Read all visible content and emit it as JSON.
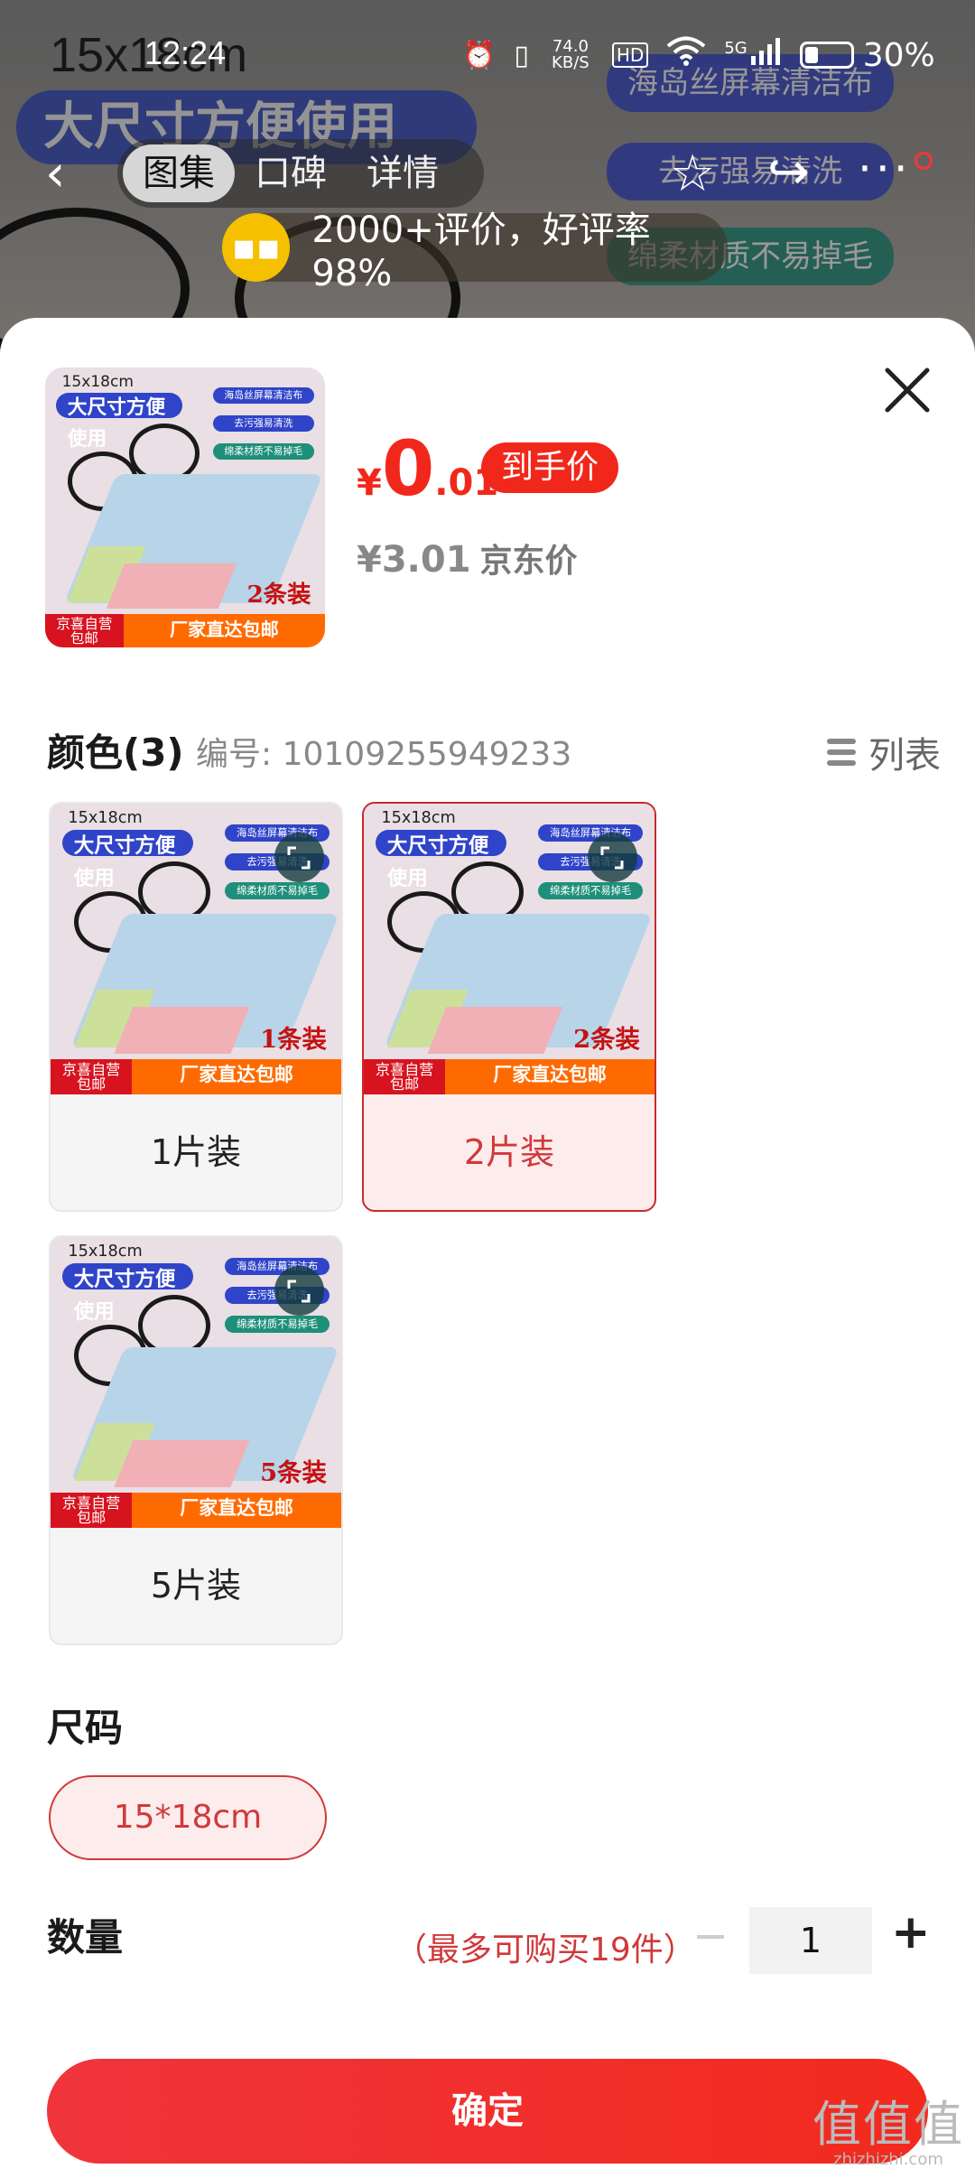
{
  "status_bar": {
    "time": "12:24",
    "net_speed": "74.0 KB/S",
    "net_type": "5G",
    "hd": "HD",
    "battery": "30%"
  },
  "background": {
    "size_text": "15x18cm",
    "banner": "大尺寸方便使用",
    "pills": [
      "海岛丝屏幕清洁布",
      "去污强易清洗",
      "绵柔材质不易掉毛"
    ]
  },
  "top_nav": {
    "tabs": [
      "图集",
      "口碑",
      "详情"
    ],
    "active_tab": 0,
    "back_icon": "chevron-left-icon",
    "star_icon": "star-outline-icon",
    "share_icon": "share-icon",
    "more_icon": "more-dots-icon"
  },
  "review_pill": {
    "text": "2000+评价，好评率98%"
  },
  "product": {
    "price_symbol": "¥",
    "price_int": "0",
    "price_dec": ".01",
    "hand_price_label": "到手价",
    "jd_price": "¥3.01",
    "jd_price_label": "京东价",
    "thumb": {
      "size_text": "15x18cm",
      "band": "大尺寸方便使用",
      "tags": [
        "海岛丝屏幕清洁布",
        "去污强易清洗",
        "绵柔材质不易掉毛"
      ],
      "jd_self": "京喜自营",
      "free_ship": "包邮",
      "factory": "厂家直达包邮",
      "count": "2条装"
    }
  },
  "color_section": {
    "title": "颜色(3)",
    "code": "编号: 10109255949233",
    "list_toggle": "列表",
    "variants": [
      {
        "label": "1片装",
        "count": "1条装",
        "selected": false
      },
      {
        "label": "2片装",
        "count": "2条装",
        "selected": true
      },
      {
        "label": "5片装",
        "count": "5条装",
        "selected": false
      }
    ]
  },
  "size_section": {
    "title": "尺码",
    "options": [
      "15*18cm"
    ],
    "selected": "15*18cm"
  },
  "quantity": {
    "title": "数量",
    "limit": "（最多可购买19件）",
    "value": "1",
    "minus": "−",
    "plus": "+"
  },
  "confirm": {
    "label": "确定"
  },
  "watermark": {
    "main": "值值值",
    "sub": "zhizhizhi.com"
  },
  "colors": {
    "accent": "#f2271b",
    "selected_border": "#c92a2a",
    "selected_bg": "#fdecec"
  }
}
